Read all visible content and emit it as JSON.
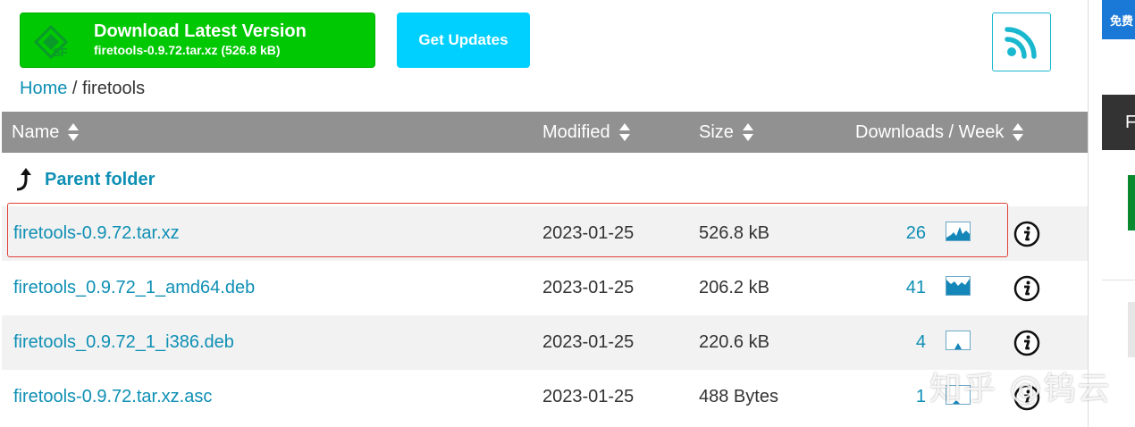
{
  "download_button": {
    "title": "Download Latest Version",
    "subtitle": "firetools-0.9.72.tar.xz (526.8 kB)",
    "logo_label": "SF"
  },
  "get_updates_label": "Get Updates",
  "breadcrumb": {
    "home": "Home",
    "separator": "/",
    "current": "firetools"
  },
  "table": {
    "headers": {
      "name": "Name",
      "modified": "Modified",
      "size": "Size",
      "downloads": "Downloads / Week"
    },
    "parent_folder": "Parent folder",
    "rows": [
      {
        "name": "firetools-0.9.72.tar.xz",
        "modified": "2023-01-25",
        "size": "526.8 kB",
        "downloads": "26"
      },
      {
        "name": "firetools_0.9.72_1_amd64.deb",
        "modified": "2023-01-25",
        "size": "206.2 kB",
        "downloads": "41"
      },
      {
        "name": "firetools_0.9.72_1_i386.deb",
        "modified": "2023-01-25",
        "size": "220.6 kB",
        "downloads": "4"
      },
      {
        "name": "firetools-0.9.72.tar.xz.asc",
        "modified": "2023-01-25",
        "size": "488 Bytes",
        "downloads": "1"
      }
    ]
  },
  "sidebar": {
    "free_label": "免费",
    "dark_label": "F"
  },
  "watermark": "知乎 @钨云",
  "colors": {
    "download_green": "#00c802",
    "updates_cyan": "#00d0ff",
    "link_blue": "#0e8fb4",
    "header_gray": "#919191",
    "highlight_red": "#e0413a"
  },
  "icons": {
    "download_logo": "sourceforge-logo-icon",
    "rss": "rss-feed-icon",
    "sort": "sort-arrows-icon",
    "parent": "up-arrow-icon",
    "sparkline": "sparkline-chart-icon",
    "info": "info-icon"
  }
}
